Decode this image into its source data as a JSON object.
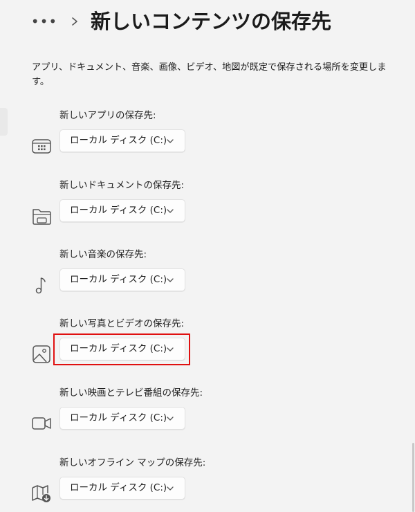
{
  "header": {
    "more_label": "•••",
    "title": "新しいコンテンツの保存先"
  },
  "description": "アプリ、ドキュメント、音楽、画像、ビデオ、地図が既定で保存される場所を変更します。",
  "sections": [
    {
      "label": "新しいアプリの保存先:",
      "value": "ローカル ディスク (C:)",
      "icon": "app-icon"
    },
    {
      "label": "新しいドキュメントの保存先:",
      "value": "ローカル ディスク (C:)",
      "icon": "folder-icon"
    },
    {
      "label": "新しい音楽の保存先:",
      "value": "ローカル ディスク (C:)",
      "icon": "music-note-icon"
    },
    {
      "label": "新しい写真とビデオの保存先:",
      "value": "ローカル ディスク (C:)",
      "icon": "image-icon"
    },
    {
      "label": "新しい映画とテレビ番組の保存先:",
      "value": "ローカル ディスク (C:)",
      "icon": "video-icon"
    },
    {
      "label": "新しいオフライン マップの保存先:",
      "value": "ローカル ディスク (C:)",
      "icon": "map-download-icon"
    }
  ],
  "colors": {
    "background": "#f3f3f3",
    "dropdown_bg": "#fdfdfd",
    "highlight": "#e01010"
  }
}
